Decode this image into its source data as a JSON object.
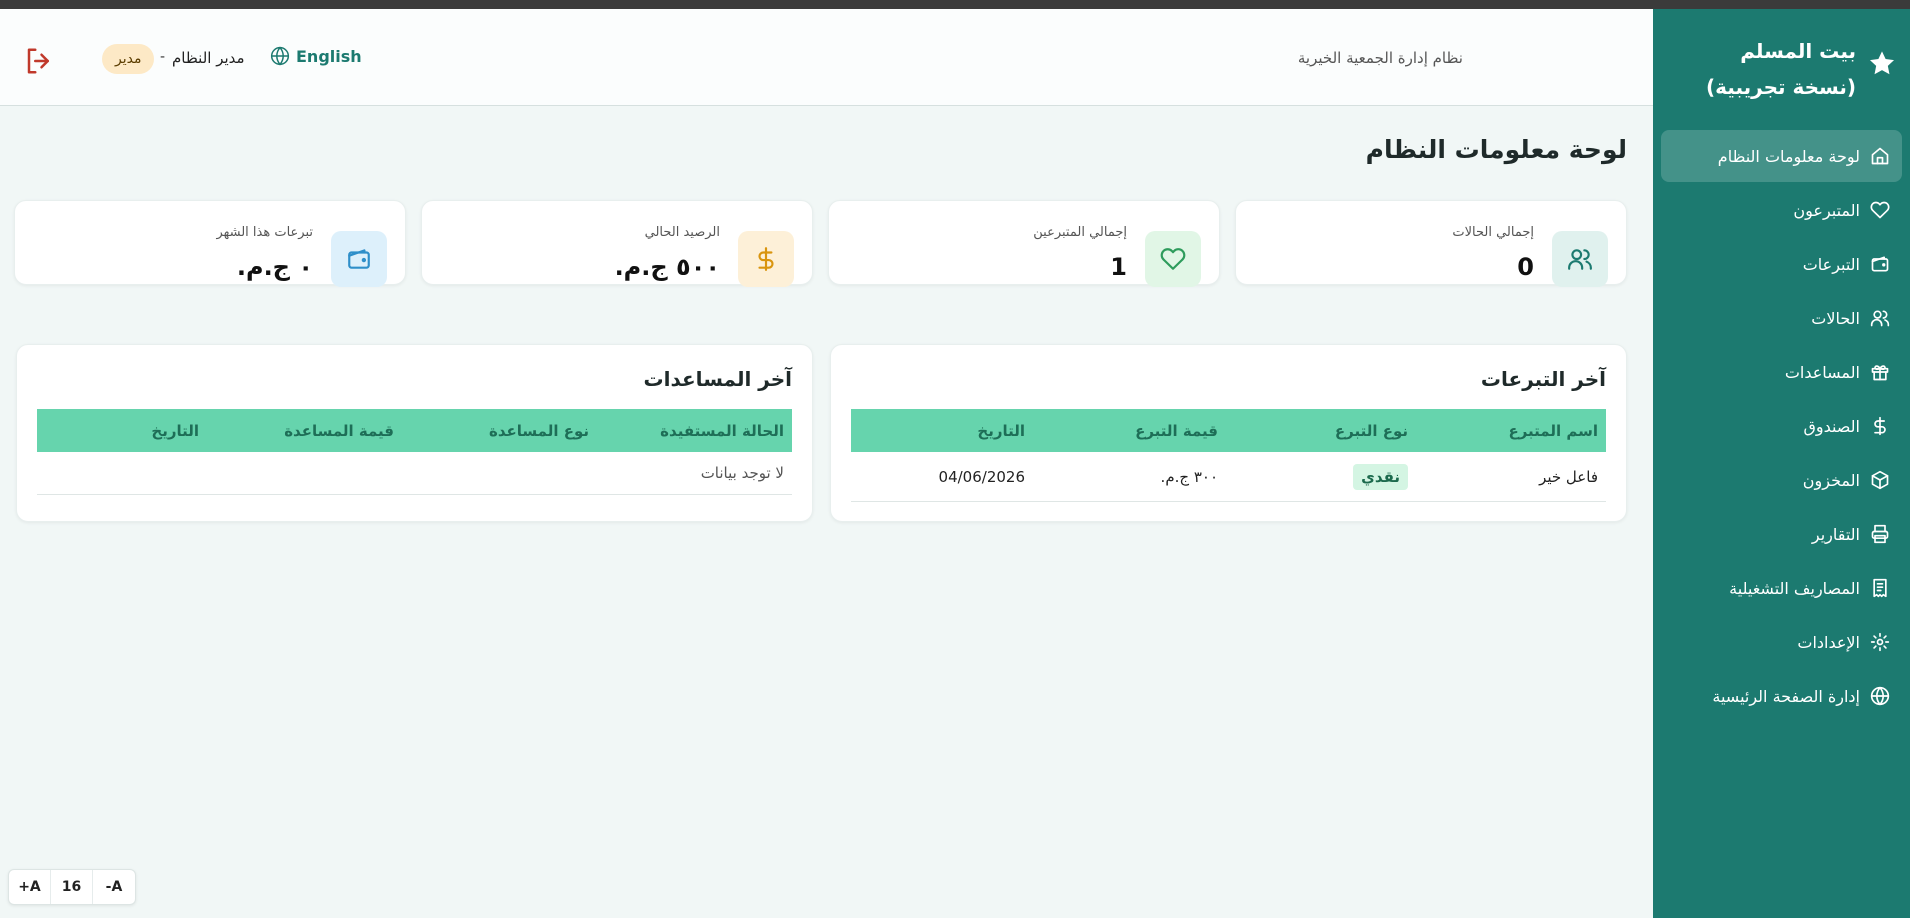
{
  "sidebar": {
    "brand": "بيت المسلم (نسخة تجريبية)",
    "items": [
      {
        "label": "لوحة معلومات النظام",
        "icon": "home-icon",
        "active": true
      },
      {
        "label": "المتبرعون",
        "icon": "heart-icon"
      },
      {
        "label": "التبرعات",
        "icon": "wallet-icon"
      },
      {
        "label": "الحالات",
        "icon": "users-icon"
      },
      {
        "label": "المساعدات",
        "icon": "gift-icon"
      },
      {
        "label": "الصندوق",
        "icon": "dollar-icon"
      },
      {
        "label": "المخزون",
        "icon": "box-icon"
      },
      {
        "label": "التقارير",
        "icon": "printer-icon"
      },
      {
        "label": "المصاريف التشغيلية",
        "icon": "receipt-icon"
      },
      {
        "label": "الإعدادات",
        "icon": "gear-icon"
      },
      {
        "label": "إدارة الصفحة الرئيسية",
        "icon": "globe-icon"
      }
    ]
  },
  "header": {
    "system_name": "نظام إدارة الجمعية الخيرية",
    "language": "English",
    "user_name": "مدير النظام",
    "separator": "-",
    "role": "مدير"
  },
  "page_title": "لوحة معلومات النظام",
  "stats": [
    {
      "label": "إجمالي الحالات",
      "value": "0",
      "icon": "users-icon",
      "accent": "#1c7a70",
      "bg": "#e0f1ee"
    },
    {
      "label": "إجمالي المتبرعين",
      "value": "1",
      "icon": "heart-icon",
      "accent": "#2e9c5c",
      "bg": "#e1f6e6"
    },
    {
      "label": "الرصيد الحالي",
      "value": "٥٠٠ ج.م.",
      "icon": "dollar-icon",
      "accent": "#d9950f",
      "bg": "#fdf0d8"
    },
    {
      "label": "تبرعات هذا الشهر",
      "value": "٠ ج.م.",
      "icon": "wallet-icon",
      "accent": "#2f8fc9",
      "bg": "#ddf0fb"
    }
  ],
  "latest_donations": {
    "title": "آخر التبرعات",
    "columns": [
      "اسم المتبرع",
      "نوع التبرع",
      "قيمة التبرع",
      "التاريخ"
    ],
    "rows": [
      {
        "donor": "فاعل خير",
        "type": "نقدي",
        "amount": "٣٠٠ ج.م.",
        "date": "04/06/2026"
      }
    ]
  },
  "latest_aids": {
    "title": "آخر المساعدات",
    "columns": [
      "الحالة المستفيدة",
      "نوع المساعدة",
      "قيمة المساعدة",
      "التاريخ"
    ],
    "empty": "لا توجد بيانات"
  },
  "font_controls": {
    "increase": "+A",
    "size": "16",
    "decrease": "-A"
  },
  "colors": {
    "primary": "#1c7a70",
    "table_header": "#66d4ad"
  }
}
